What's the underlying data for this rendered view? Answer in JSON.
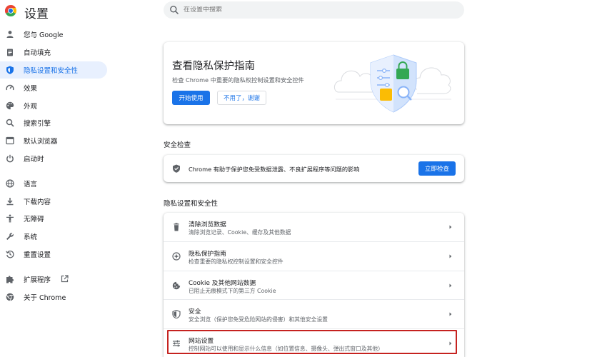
{
  "header": {
    "title": "设置",
    "search_placeholder": "在设置中搜索"
  },
  "sidebar": {
    "items": [
      {
        "label": "您与 Google",
        "icon": "person-icon"
      },
      {
        "label": "自动填充",
        "icon": "clipboard-icon"
      },
      {
        "label": "隐私设置和安全性",
        "icon": "shield-icon",
        "active": true
      },
      {
        "label": "效果",
        "icon": "speedometer-icon"
      },
      {
        "label": "外观",
        "icon": "palette-icon"
      },
      {
        "label": "搜索引擎",
        "icon": "search-icon"
      },
      {
        "label": "默认浏览器",
        "icon": "browser-icon"
      },
      {
        "label": "启动时",
        "icon": "power-icon"
      },
      {
        "label": "语言",
        "icon": "globe-icon"
      },
      {
        "label": "下载内容",
        "icon": "download-icon"
      },
      {
        "label": "无障碍",
        "icon": "accessibility-icon"
      },
      {
        "label": "系统",
        "icon": "wrench-icon"
      },
      {
        "label": "重置设置",
        "icon": "history-icon"
      },
      {
        "label": "扩展程序",
        "icon": "puzzle-icon"
      },
      {
        "label": "关于 Chrome",
        "icon": "chrome-icon"
      }
    ]
  },
  "hero": {
    "title": "查看隐私保护指南",
    "description": "检查 Chrome 中重要的隐私权控制设置和安全控件",
    "start_label": "开始使用",
    "dismiss_label": "不用了，谢谢"
  },
  "safety": {
    "section_title": "安全检查",
    "text": "Chrome 有助于保护您免受数据泄露、不良扩展程序等问题的影响",
    "button_label": "立即检查"
  },
  "privacy": {
    "section_title": "隐私设置和安全性",
    "rows": [
      {
        "title": "清除浏览数据",
        "subtitle": "清除浏览记录、Cookie、缓存及其他数据",
        "icon": "trash-icon"
      },
      {
        "title": "隐私保护指南",
        "subtitle": "检查重要的隐私权控制设置和安全控件",
        "icon": "compass-icon"
      },
      {
        "title": "Cookie 及其他网站数据",
        "subtitle": "已阻止无痕模式下的第三方 Cookie",
        "icon": "cookie-icon"
      },
      {
        "title": "安全",
        "subtitle": "安全浏览（保护您免受危险网站的侵害）和其他安全设置",
        "icon": "shield-icon"
      },
      {
        "title": "网站设置",
        "subtitle": "控制网站可以使用和显示什么信息（如位置信息、摄像头、弹出式窗口及其他）",
        "icon": "sliders-icon"
      }
    ]
  },
  "colors": {
    "accent": "#1a73e8",
    "active_bg": "#e8f0fe",
    "highlight": "#c5221f"
  }
}
